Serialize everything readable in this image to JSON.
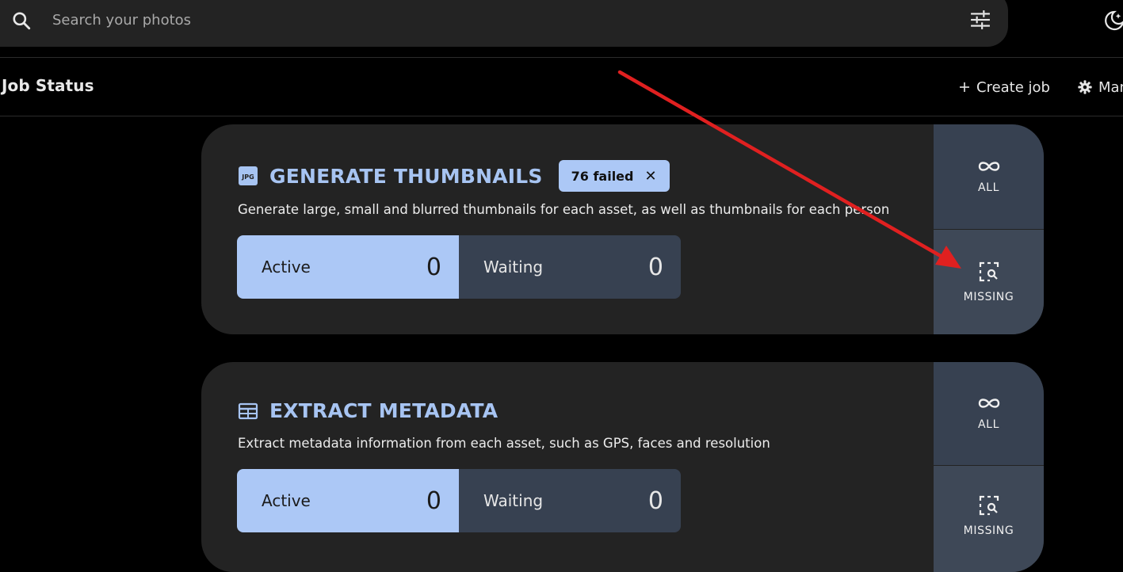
{
  "search": {
    "placeholder": "Search your photos"
  },
  "header": {
    "title": "Job Status",
    "create_job_label": "Create job",
    "manage_label": "Man"
  },
  "jobs": [
    {
      "title": "GENERATE THUMBNAILS",
      "icon": "jpg-file-icon",
      "failed_badge": "76 failed",
      "description": "Generate large, small and blurred thumbnails for each asset, as well as thumbnails for each person",
      "active_label": "Active",
      "active_value": "0",
      "waiting_label": "Waiting",
      "waiting_value": "0",
      "all_label": "ALL",
      "missing_label": "MISSING"
    },
    {
      "title": "EXTRACT METADATA",
      "icon": "table-icon",
      "description": "Extract metadata information from each asset, such as GPS, faces and resolution",
      "active_label": "Active",
      "active_value": "0",
      "waiting_label": "Waiting",
      "waiting_value": "0",
      "all_label": "ALL",
      "missing_label": "MISSING"
    }
  ],
  "colors": {
    "background": "#000000",
    "card": "#232323",
    "accent": "#acc8f6",
    "title": "#a7c4f2",
    "side_button": "#374151",
    "annotation_arrow": "#e02020"
  }
}
